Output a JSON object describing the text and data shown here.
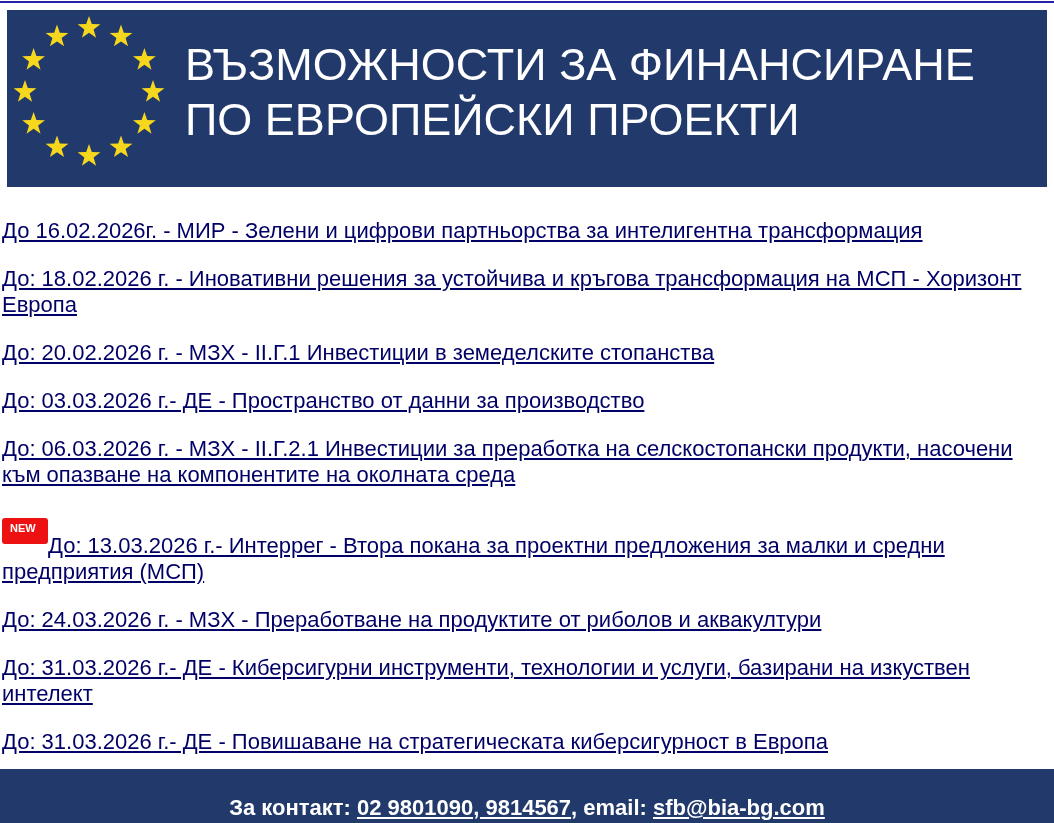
{
  "banner": {
    "title_lines": [
      "ВЪЗМОЖНОСТИ ЗА ФИНАНСИРАНЕ",
      "ПО ЕВРОПЕЙСКИ ПРОЕКТИ"
    ]
  },
  "links": [
    {
      "text": "До 16.02.2026г. - МИР - Зелени и цифрови партньорства за интелигентна трансформация"
    },
    {
      "text": "До: 18.02.2026 г. - Иновативни решения за устойчива и кръгова трансформация на МСП - Хоризонт Европа"
    },
    {
      "text": "До: 20.02.2026 г. - МЗХ - II.Г.1 Инвестиции в земеделските стопанства"
    },
    {
      "text": "До: 03.03.2026 г.- ДЕ - Пространство от данни за производство"
    },
    {
      "text": "До: 06.03.2026 г. - МЗХ - II.Г.2.1 Инвестиции за преработка на селскостопански продукти, насочени към опазване на компонентите на околната среда"
    },
    {
      "text": "До: 13.03.2026 г.- Интеррег - Втора покана за проектни предложения за малки и средни предприятия (МСП)",
      "badge": "NEW"
    },
    {
      "text": "До: 24.03.2026 г. - МЗХ - Преработване на продуктите от риболов и аквакултури"
    },
    {
      "text": "До: 31.03.2026 г.- ДЕ - Киберсигурни инструменти, технологии и услуги, базирани на изкуствен интелект"
    },
    {
      "text": "До: 31.03.2026 г.- ДЕ - Повишаване на стратегическата киберсигурност в Европа"
    }
  ],
  "footer": {
    "label": "За контакт: ",
    "phones": "02 9801090, 9814567",
    "email_label": ", email: ",
    "email": "sfb@bia-bg.com"
  }
}
